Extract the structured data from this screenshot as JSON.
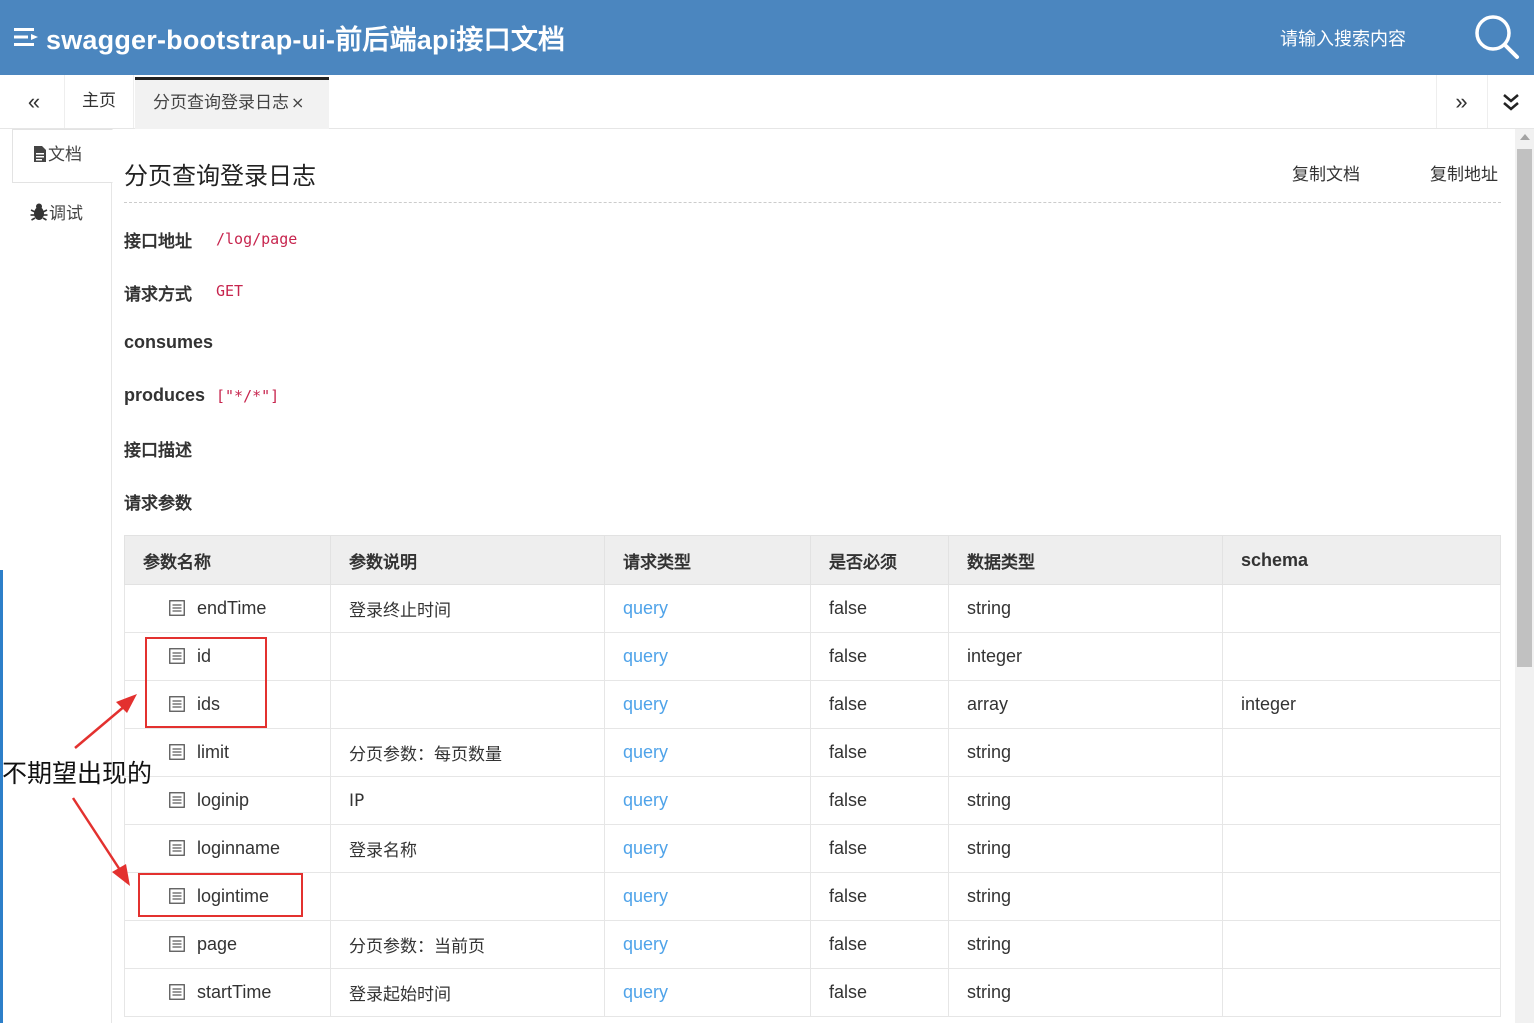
{
  "header": {
    "menu_icon": "menu-icon",
    "title": "swagger-bootstrap-ui-前后端api接口文档",
    "search_placeholder": "请输入搜索内容",
    "search_icon": "search-icon",
    "background": "#4b86bf"
  },
  "tabs": {
    "prev_icon": "double-chevron-left-icon",
    "home": "主页",
    "active": "分页查询登录日志",
    "close": "×",
    "next_icon": "double-chevron-right-icon",
    "more_icon": "double-chevron-down-icon"
  },
  "side_tabs": {
    "doc": "文档",
    "doc_icon": "file-icon",
    "debug": "调试",
    "debug_icon": "bug-icon"
  },
  "doc": {
    "title": "分页查询登录日志",
    "copy_doc": "复制文档",
    "copy_url": "复制地址",
    "address_label": "接口地址",
    "address_value": "/log/page",
    "method_label": "请求方式",
    "method_value": "GET",
    "consumes_label": "consumes",
    "produces_label": "produces",
    "produces_value": "[\"*/*\"]",
    "description_label": "接口描述",
    "params_label": "请求参数"
  },
  "params_table": {
    "headers": [
      "参数名称",
      "参数说明",
      "请求类型",
      "是否必须",
      "数据类型",
      "schema"
    ],
    "row_icon": "list-icon",
    "rows": [
      {
        "name": "endTime",
        "desc": "登录终止时间",
        "in": "query",
        "required": "false",
        "type": "string",
        "schema": ""
      },
      {
        "name": "id",
        "desc": "",
        "in": "query",
        "required": "false",
        "type": "integer",
        "schema": ""
      },
      {
        "name": "ids",
        "desc": "",
        "in": "query",
        "required": "false",
        "type": "array",
        "schema": "integer"
      },
      {
        "name": "limit",
        "desc": "分页参数：每页数量",
        "in": "query",
        "required": "false",
        "type": "string",
        "schema": ""
      },
      {
        "name": "loginip",
        "desc": "IP",
        "in": "query",
        "required": "false",
        "type": "string",
        "schema": ""
      },
      {
        "name": "loginname",
        "desc": "登录名称",
        "in": "query",
        "required": "false",
        "type": "string",
        "schema": ""
      },
      {
        "name": "logintime",
        "desc": "",
        "in": "query",
        "required": "false",
        "type": "string",
        "schema": ""
      },
      {
        "name": "page",
        "desc": "分页参数：当前页",
        "in": "query",
        "required": "false",
        "type": "string",
        "schema": ""
      },
      {
        "name": "startTime",
        "desc": "登录起始时间",
        "in": "query",
        "required": "false",
        "type": "string",
        "schema": ""
      }
    ]
  },
  "annotation": {
    "text": "不期望出现的",
    "color": "#e3312f"
  }
}
